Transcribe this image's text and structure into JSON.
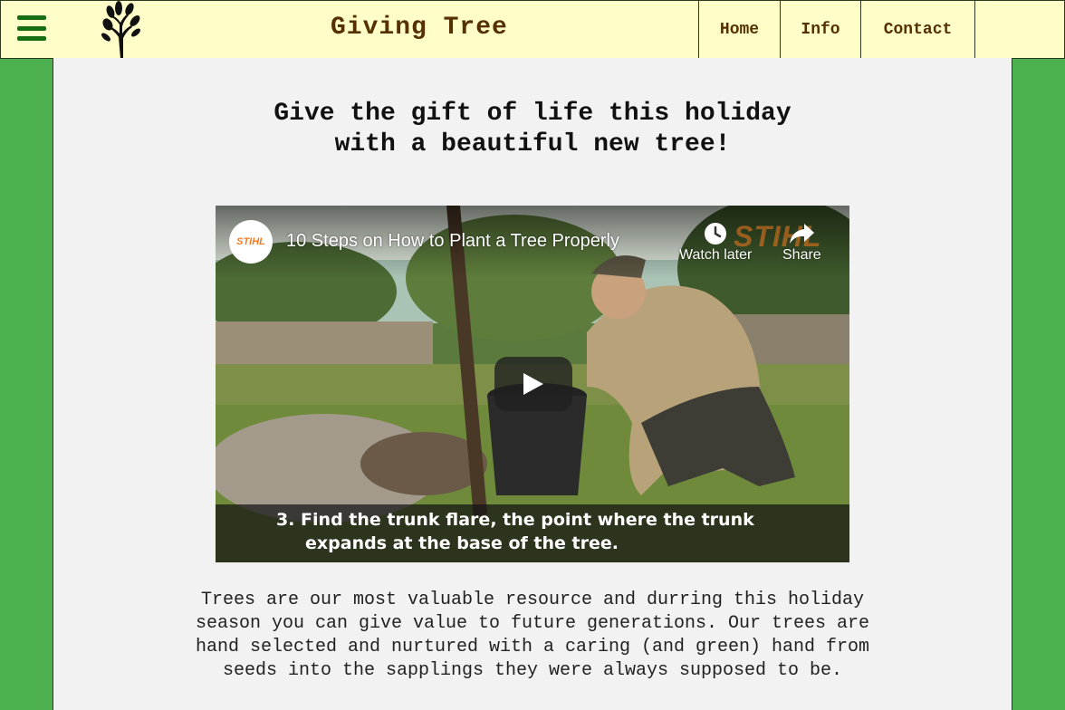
{
  "header": {
    "site_title": "Giving Tree",
    "nav": [
      {
        "label": "Home"
      },
      {
        "label": "Info"
      },
      {
        "label": "Contact"
      }
    ]
  },
  "main": {
    "headline_line1": "Give the gift of life this holiday",
    "headline_line2": "with a beautiful new tree!",
    "video": {
      "channel_badge": "STIHL",
      "title": "10 Steps on How to Plant a Tree Properly",
      "watermark": "STIHL",
      "watch_later_label": "Watch later",
      "share_label": "Share",
      "caption_line1": "3.  Find the trunk flare, the point where the trunk",
      "caption_line2": "expands at the base of the tree."
    },
    "body_line1": "Trees are our most valuable resource and durring this holiday",
    "body_line2": "season you can give value to future generations. Our trees are",
    "body_line3": "hand selected and nurtured with a caring (and green) hand from",
    "body_line4": "seeds into the sapplings they were always supposed to be."
  },
  "colors": {
    "page_background": "#4caf50",
    "header_background": "#fffdc8",
    "header_text": "#553000",
    "hamburger": "#166d12",
    "content_background": "#f2f2f2",
    "brand_orange": "#f37a1f"
  },
  "icons": [
    "hamburger-menu-icon",
    "tree-logo-icon",
    "clock-icon",
    "share-arrow-icon",
    "play-icon"
  ]
}
